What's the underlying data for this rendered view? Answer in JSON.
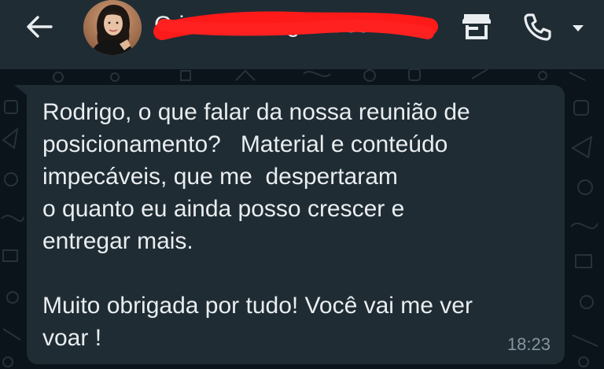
{
  "header": {
    "contact_name": "Cristiane Magalhães",
    "back_icon": "arrow-left-icon",
    "shop_icon": "storefront-icon",
    "call_icon": "phone-icon",
    "menu_icon": "caret-down-icon"
  },
  "message": {
    "text": "Rodrigo, o que falar da nossa reunião de\nposicionamento?   Material e conteúdo\nimpecáveis, que me  despertaram\no quanto eu ainda posso crescer e\nentregar mais.\n\nMuito obrigada por tudo! Você vai me ver\nvoar !",
    "time": "18:23"
  },
  "colors": {
    "header_bg": "#1f2c34",
    "chat_bg": "#0b141a",
    "bubble_bg": "#1f2c34",
    "text": "#e9edef",
    "timestamp": "#8696a0",
    "redaction": "#ff1a1a"
  }
}
